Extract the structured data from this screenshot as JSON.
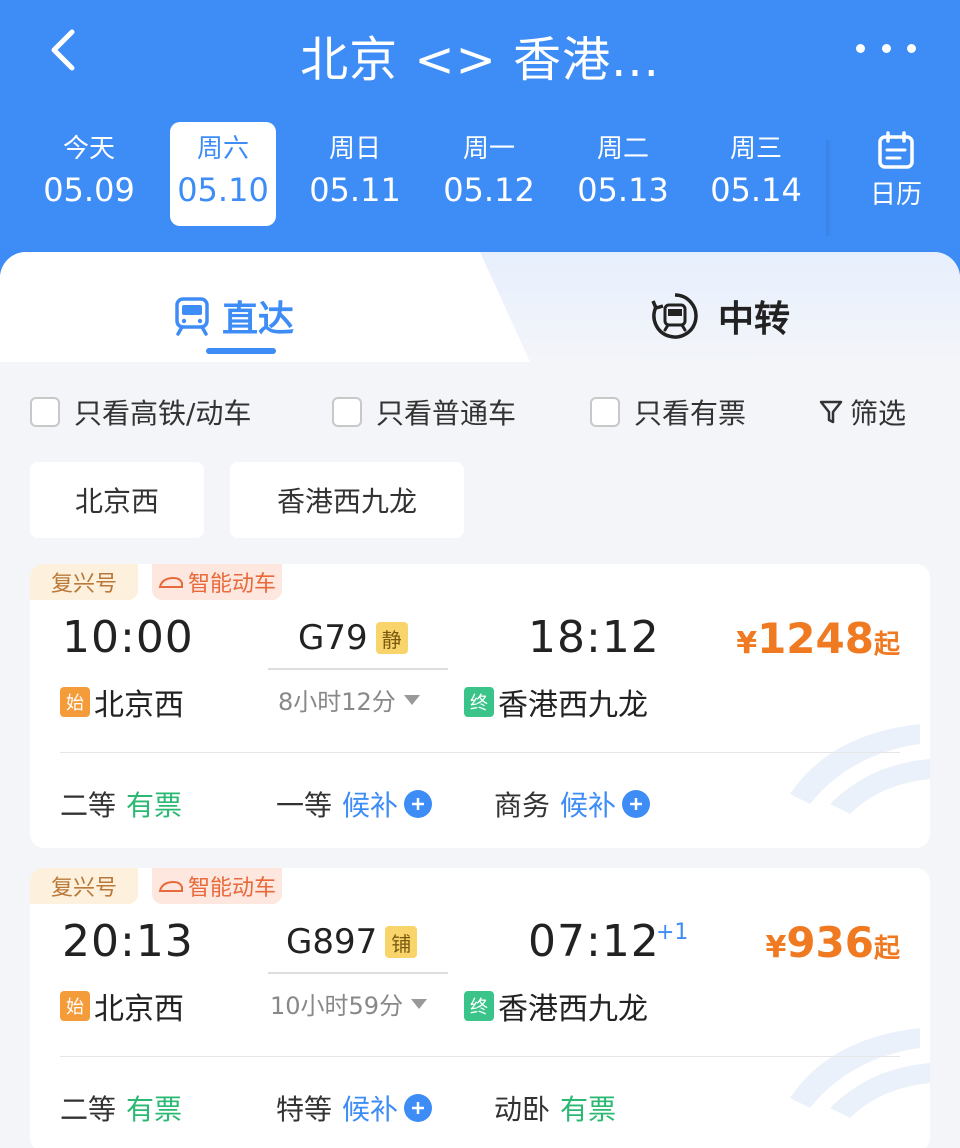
{
  "header": {
    "title": "北京 <> 香港..."
  },
  "dates": [
    {
      "weekday": "今天",
      "date": "05.09"
    },
    {
      "weekday": "周六",
      "date": "05.10"
    },
    {
      "weekday": "周日",
      "date": "05.11"
    },
    {
      "weekday": "周一",
      "date": "05.12"
    },
    {
      "weekday": "周二",
      "date": "05.13"
    },
    {
      "weekday": "周三",
      "date": "05.14"
    }
  ],
  "calendar_label": "日历",
  "tabs": {
    "direct": "直达",
    "transfer": "中转"
  },
  "filters": {
    "high_speed": "只看高铁/动车",
    "normal": "只看普通车",
    "available": "只看有票",
    "screen": "筛选"
  },
  "stations": [
    "北京西",
    "香港西九龙"
  ],
  "trains": [
    {
      "brand": "复兴号",
      "smart": "智能动车",
      "dep_time": "10:00",
      "train_no": "G79",
      "seat_tag": "静",
      "arr_time": "18:12",
      "plus_day": "",
      "duration": "8小时12分",
      "start_tag": "始",
      "start_station": "北京西",
      "end_tag": "终",
      "end_station": "香港西九龙",
      "price_currency": "¥",
      "price": "1248",
      "price_suffix": "起",
      "seats": [
        {
          "class": "二等",
          "status": "有票"
        },
        {
          "class": "一等",
          "status": "候补"
        },
        {
          "class": "商务",
          "status": "候补"
        }
      ]
    },
    {
      "brand": "复兴号",
      "smart": "智能动车",
      "dep_time": "20:13",
      "train_no": "G897",
      "seat_tag": "铺",
      "arr_time": "07:12",
      "plus_day": "+1",
      "duration": "10小时59分",
      "start_tag": "始",
      "start_station": "北京西",
      "end_tag": "终",
      "end_station": "香港西九龙",
      "price_currency": "¥",
      "price": "936",
      "price_suffix": "起",
      "seats": [
        {
          "class": "二等",
          "status": "有票"
        },
        {
          "class": "特等",
          "status": "候补"
        },
        {
          "class": "动卧",
          "status": "有票"
        }
      ]
    }
  ],
  "colors": {
    "primary": "#3e8df6",
    "price": "#f07a22",
    "available": "#2bb873"
  }
}
